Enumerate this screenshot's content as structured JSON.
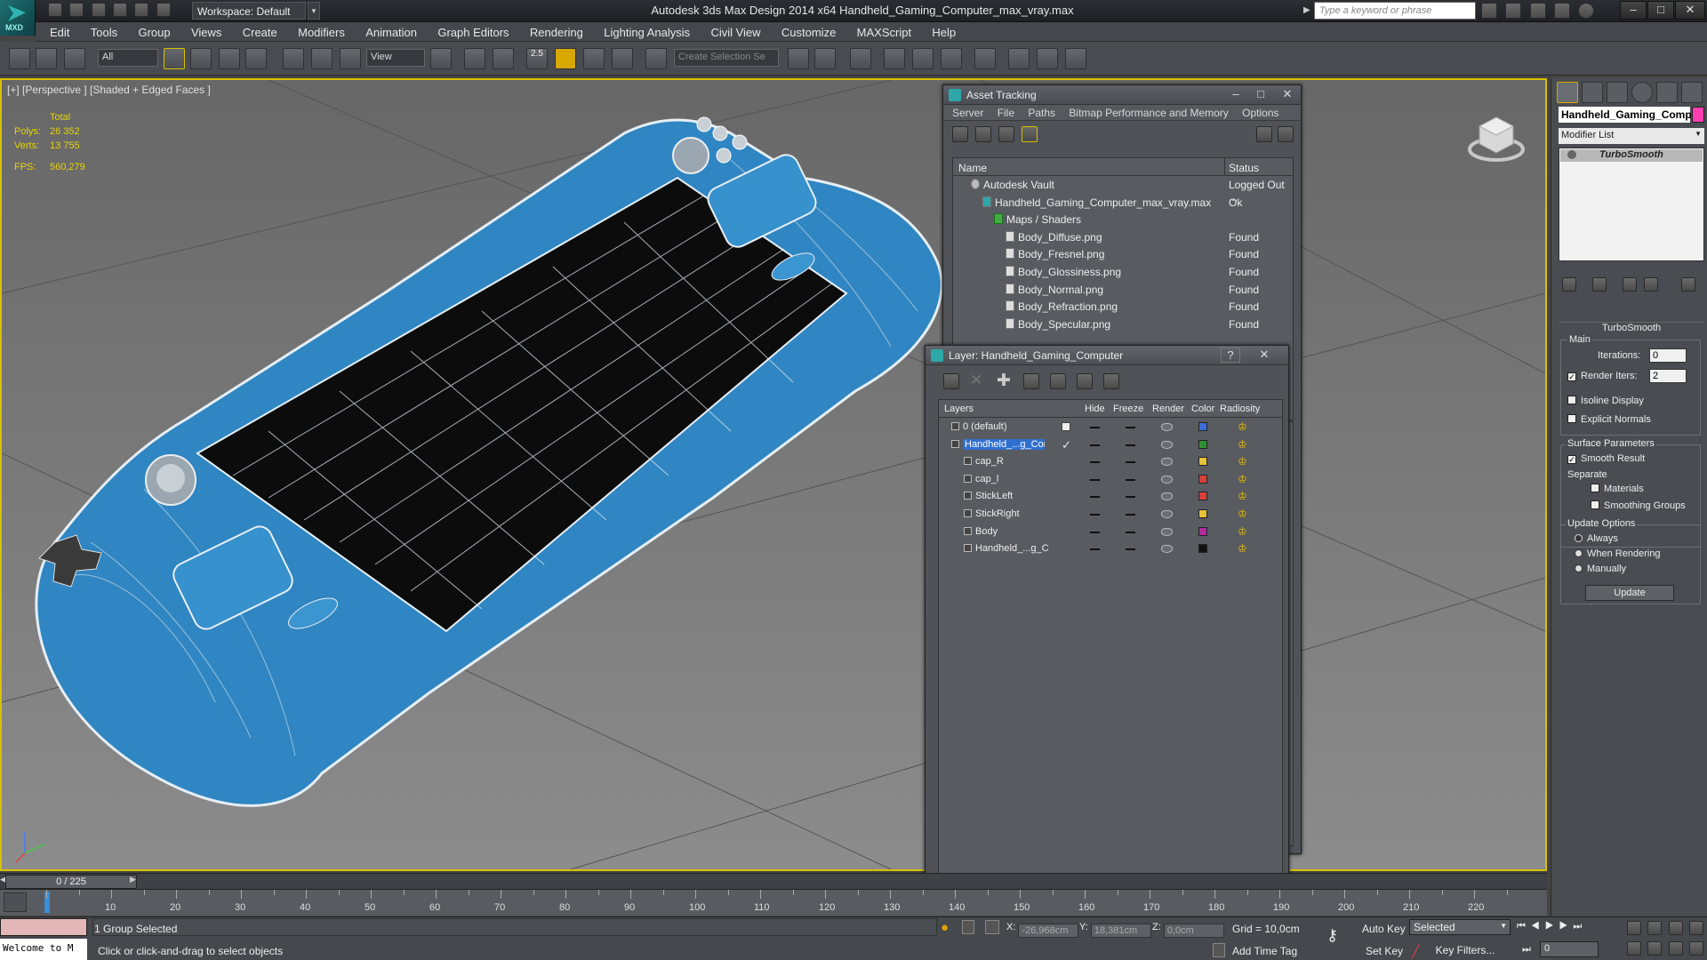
{
  "titlebar": {
    "workspace": "Workspace: Default",
    "title": "Autodesk 3ds Max Design 2014 x64     Handheld_Gaming_Computer_max_vray.max",
    "search_placeholder": "Type a keyword or phrase",
    "logo_text": "MXD"
  },
  "menu": [
    "Edit",
    "Tools",
    "Group",
    "Views",
    "Create",
    "Modifiers",
    "Animation",
    "Graph Editors",
    "Rendering",
    "Lighting Analysis",
    "Civil View",
    "Customize",
    "MAXScript",
    "Help"
  ],
  "toolbar": {
    "filter_select": "All",
    "view_select": "View",
    "snap_value": "2.5",
    "selection_set_placeholder": "Create Selection Se"
  },
  "viewport": {
    "label": "[+] [Perspective ] [Shaded + Edged Faces ]",
    "stats_header": "Total",
    "polys_label": "Polys:",
    "polys_value": "26 352",
    "verts_label": "Verts:",
    "verts_value": "13 755",
    "fps_label": "FPS:",
    "fps_value": "560,279",
    "model_color": "#2f86c2"
  },
  "asset_tracking": {
    "title": "Asset Tracking",
    "menu": [
      "Server",
      "File",
      "Paths",
      "Bitmap Performance and Memory",
      "Options"
    ],
    "col_name": "Name",
    "col_status": "Status",
    "rows": [
      {
        "name": "Autodesk Vault",
        "status": "Logged Out ...",
        "indent": 0,
        "icon": "vault-icon"
      },
      {
        "name": "Handheld_Gaming_Computer_max_vray.max",
        "status": "Ok",
        "indent": 1,
        "icon": "max-file-icon"
      },
      {
        "name": "Maps / Shaders",
        "status": "",
        "indent": 2,
        "icon": "maps-folder-icon"
      },
      {
        "name": "Body_Diffuse.png",
        "status": "Found",
        "indent": 3,
        "icon": "image-file-icon"
      },
      {
        "name": "Body_Fresnel.png",
        "status": "Found",
        "indent": 3,
        "icon": "image-file-icon"
      },
      {
        "name": "Body_Glossiness.png",
        "status": "Found",
        "indent": 3,
        "icon": "image-file-icon"
      },
      {
        "name": "Body_Normal.png",
        "status": "Found",
        "indent": 3,
        "icon": "image-file-icon"
      },
      {
        "name": "Body_Refraction.png",
        "status": "Found",
        "indent": 3,
        "icon": "image-file-icon"
      },
      {
        "name": "Body_Specular.png",
        "status": "Found",
        "indent": 3,
        "icon": "image-file-icon"
      }
    ]
  },
  "layer_dialog": {
    "title": "Layer: Handheld_Gaming_Computer",
    "columns": [
      "Layers",
      "Hide",
      "Freeze",
      "Render",
      "Color",
      "Radiosity"
    ],
    "rows": [
      {
        "name": "0 (default)",
        "indent": 0,
        "color": "#3d6fd6",
        "selected": false,
        "check": "box"
      },
      {
        "name": "Handheld_...g_Com",
        "indent": 0,
        "color": "#2f8f2f",
        "selected": true,
        "check": "mark"
      },
      {
        "name": "cap_R",
        "indent": 1,
        "color": "#e8c23a",
        "selected": false,
        "check": ""
      },
      {
        "name": "cap_l",
        "indent": 1,
        "color": "#d84040",
        "selected": false,
        "check": ""
      },
      {
        "name": "StickLeft",
        "indent": 1,
        "color": "#d84040",
        "selected": false,
        "check": ""
      },
      {
        "name": "StickRight",
        "indent": 1,
        "color": "#e8c23a",
        "selected": false,
        "check": ""
      },
      {
        "name": "Body",
        "indent": 1,
        "color": "#b02aa0",
        "selected": false,
        "check": ""
      },
      {
        "name": "Handheld_...g_C",
        "indent": 1,
        "color": "#111111",
        "selected": false,
        "check": ""
      }
    ]
  },
  "command_panel": {
    "object_name": "Handheld_Gaming_Comp",
    "object_color": "#ff3fb0",
    "modifier_list": "Modifier List",
    "stack_item": "TurboSmooth",
    "rollout_title": "TurboSmooth",
    "main_label": "Main",
    "iterations_label": "Iterations:",
    "iterations_value": "0",
    "render_iters_label": "Render Iters:",
    "render_iters_value": "2",
    "isoline_label": "Isoline Display",
    "explicit_normals_label": "Explicit Normals",
    "surface_params_label": "Surface Parameters",
    "smooth_result_label": "Smooth Result",
    "separate_label": "Separate",
    "materials_label": "Materials",
    "smoothing_groups_label": "Smoothing Groups",
    "update_options_label": "Update Options",
    "always_label": "Always",
    "when_rendering_label": "When Rendering",
    "manually_label": "Manually",
    "update_button": "Update"
  },
  "timeline": {
    "frame_display": "0 / 225",
    "ticks": [
      "10",
      "20",
      "30",
      "40",
      "50",
      "60",
      "70",
      "80",
      "90",
      "100",
      "110",
      "120",
      "130",
      "140",
      "150",
      "160",
      "170",
      "180",
      "190",
      "200",
      "210",
      "220"
    ]
  },
  "status": {
    "welcome": "Welcome to M",
    "selection": "1 Group Selected",
    "prompt": "Click or click-and-drag to select objects",
    "x_label": "X:",
    "x_value": "-26,968cm",
    "y_label": "Y:",
    "y_value": "18,381cm",
    "z_label": "Z:",
    "z_value": "0,0cm",
    "grid": "Grid = 10,0cm",
    "add_time_tag": "Add Time Tag",
    "auto_key": "Auto Key",
    "set_key": "Set Key",
    "selected_dropdown": "Selected",
    "key_filters": "Key Filters...",
    "current_frame": "0"
  }
}
